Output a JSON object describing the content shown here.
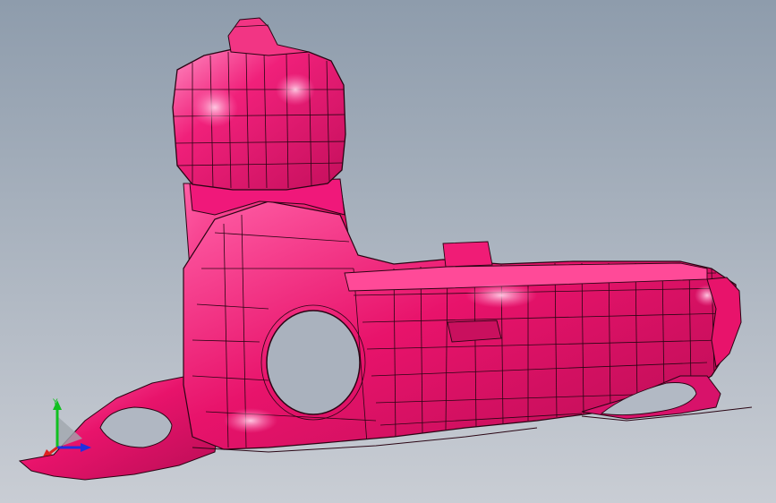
{
  "viewport": {
    "background_top": "#8e9cac",
    "background_bottom": "#c9cdd4",
    "model_color": "#e8136b",
    "model_highlight": "#ff78b8",
    "model_shadow": "#9c0c48",
    "edge_color": "#2a0514"
  },
  "triad": {
    "y_label": "Y",
    "x_color": "#e02020",
    "y_color": "#10c020",
    "z_color": "#2030e0",
    "icon": "coordinate-triad-icon"
  }
}
